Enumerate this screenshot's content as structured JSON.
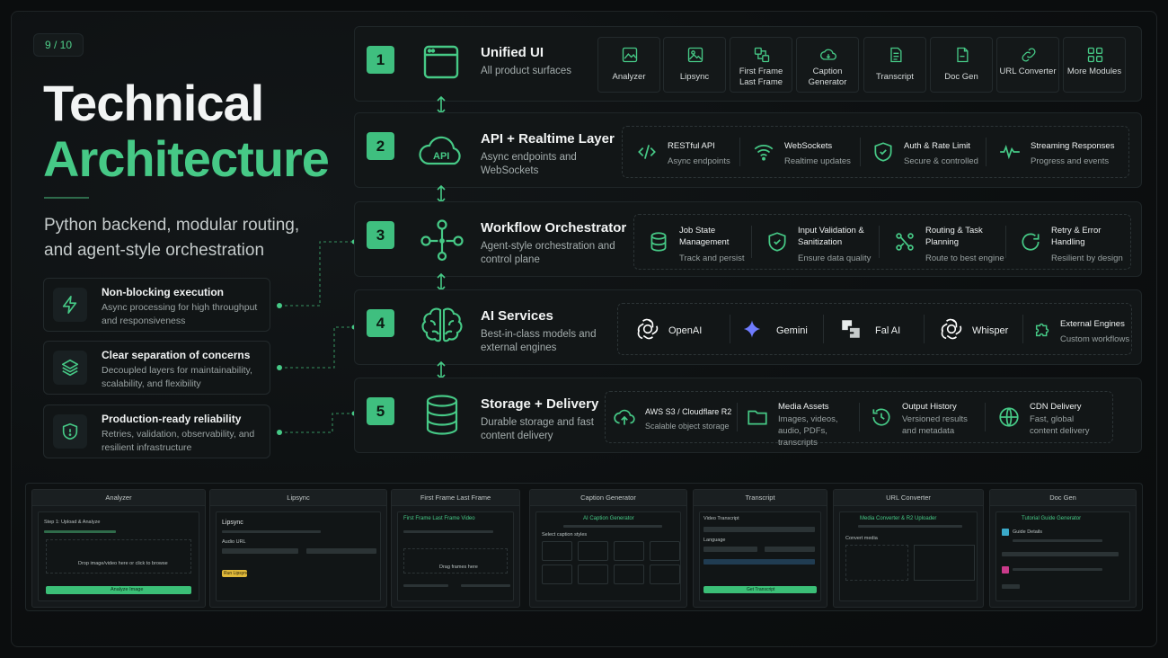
{
  "page_number": "9 / 10",
  "title": {
    "line1": "Technical",
    "line2": "Architecture"
  },
  "subtitle": "Python backend, modular routing, and agent-style orchestration",
  "features": [
    {
      "title": "Non-blocking execution",
      "desc": "Async processing for high throughput and responsiveness",
      "icon": "bolt-icon"
    },
    {
      "title": "Clear separation of concerns",
      "desc": "Decoupled layers for maintainability, scalability, and flexibility",
      "icon": "layers-icon"
    },
    {
      "title": "Production-ready reliability",
      "desc": "Retries, validation, observability, and resilient infrastructure",
      "icon": "shield-icon"
    }
  ],
  "layers": [
    {
      "num": "1",
      "title": "Unified UI",
      "desc": "All product surfaces",
      "icon": "browser-window-icon",
      "modules": [
        {
          "label": "Analyzer",
          "icon": "image-chart-icon"
        },
        {
          "label": "Lipsync",
          "icon": "image-icon"
        },
        {
          "label": "First Frame Last Frame",
          "icon": "frames-icon"
        },
        {
          "label": "Caption Generator",
          "icon": "caption-icon"
        },
        {
          "label": "Transcript",
          "icon": "document-icon"
        },
        {
          "label": "Doc Gen",
          "icon": "doc-gen-icon"
        },
        {
          "label": "URL Converter",
          "icon": "link-icon"
        },
        {
          "label": "More Modules",
          "icon": "grid-icon"
        }
      ]
    },
    {
      "num": "2",
      "title": "API + Realtime Layer",
      "desc": "Async endpoints and WebSockets",
      "icon": "api-cloud-icon",
      "items": [
        {
          "title": "RESTful API",
          "desc": "Async endpoints",
          "icon": "code-icon"
        },
        {
          "title": "WebSockets",
          "desc": "Realtime updates",
          "icon": "wifi-icon"
        },
        {
          "title": "Auth & Rate Limit",
          "desc": "Secure & controlled",
          "icon": "shield-check-icon"
        },
        {
          "title": "Streaming Responses",
          "desc": "Progress and events",
          "icon": "pulse-icon"
        }
      ]
    },
    {
      "num": "3",
      "title": "Workflow Orchestrator",
      "desc": "Agent-style orchestration and control plane",
      "icon": "workflow-icon",
      "items": [
        {
          "title": "Job State Management",
          "desc": "Track and persist",
          "icon": "database-icon"
        },
        {
          "title": "Input Validation & Sanitization",
          "desc": "Ensure data quality",
          "icon": "shield-check-icon"
        },
        {
          "title": "Routing & Task Planning",
          "desc": "Route to best engine",
          "icon": "route-icon"
        },
        {
          "title": "Retry & Error Handling",
          "desc": "Resilient by design",
          "icon": "retry-icon"
        }
      ]
    },
    {
      "num": "4",
      "title": "AI Services",
      "desc": "Best-in-class models and external engines",
      "icon": "brain-icon",
      "providers": [
        {
          "label": "OpenAI",
          "icon": "openai-icon"
        },
        {
          "label": "Gemini",
          "icon": "gemini-icon"
        },
        {
          "label": "Fal AI",
          "icon": "fal-icon"
        },
        {
          "label": "Whisper",
          "icon": "whisper-icon"
        }
      ],
      "external": {
        "title": "External Engines",
        "desc": "Custom workflows",
        "icon": "puzzle-icon"
      }
    },
    {
      "num": "5",
      "title": "Storage + Delivery",
      "desc": "Durable storage and fast content delivery",
      "icon": "storage-icon",
      "items": [
        {
          "title": "AWS S3 / Cloudflare R2",
          "desc": "Scalable object storage",
          "icon": "cloud-upload-icon"
        },
        {
          "title": "Media Assets",
          "desc": "Images, videos, audio, PDFs, transcripts",
          "icon": "folder-icon"
        },
        {
          "title": "Output History",
          "desc": "Versioned results and metadata",
          "icon": "history-icon"
        },
        {
          "title": "CDN Delivery",
          "desc": "Fast, global content delivery",
          "icon": "globe-icon"
        }
      ]
    }
  ],
  "screenshots": [
    {
      "title": "Analyzer",
      "heading": "Step 1: Upload & Analyze",
      "body": "Drop image/video here or click to browse",
      "button": "Analyze Image"
    },
    {
      "title": "Lipsync",
      "heading": "Lipsync",
      "body": "Audio URL",
      "button": "Run Lipsync"
    },
    {
      "title": "First Frame Last Frame",
      "heading": "First Frame Last Frame Video",
      "body": "Drag frames here",
      "button": ""
    },
    {
      "title": "Caption Generator",
      "heading": "AI Caption Generator",
      "body": "Select caption styles",
      "button": ""
    },
    {
      "title": "Transcript",
      "heading": "Video Transcript",
      "body": "Language",
      "button": "Get Transcript"
    },
    {
      "title": "URL Converter",
      "heading": "Media Converter & R2 Uploader",
      "body": "Convert media",
      "button": ""
    },
    {
      "title": "Doc Gen",
      "heading": "Tutorial Guide Generator",
      "body": "Guide Details",
      "button": ""
    }
  ],
  "colors": {
    "accent": "#46c986",
    "accent_box": "#3fbf7f",
    "background": "#0b0d0e",
    "panel": "#121617"
  }
}
